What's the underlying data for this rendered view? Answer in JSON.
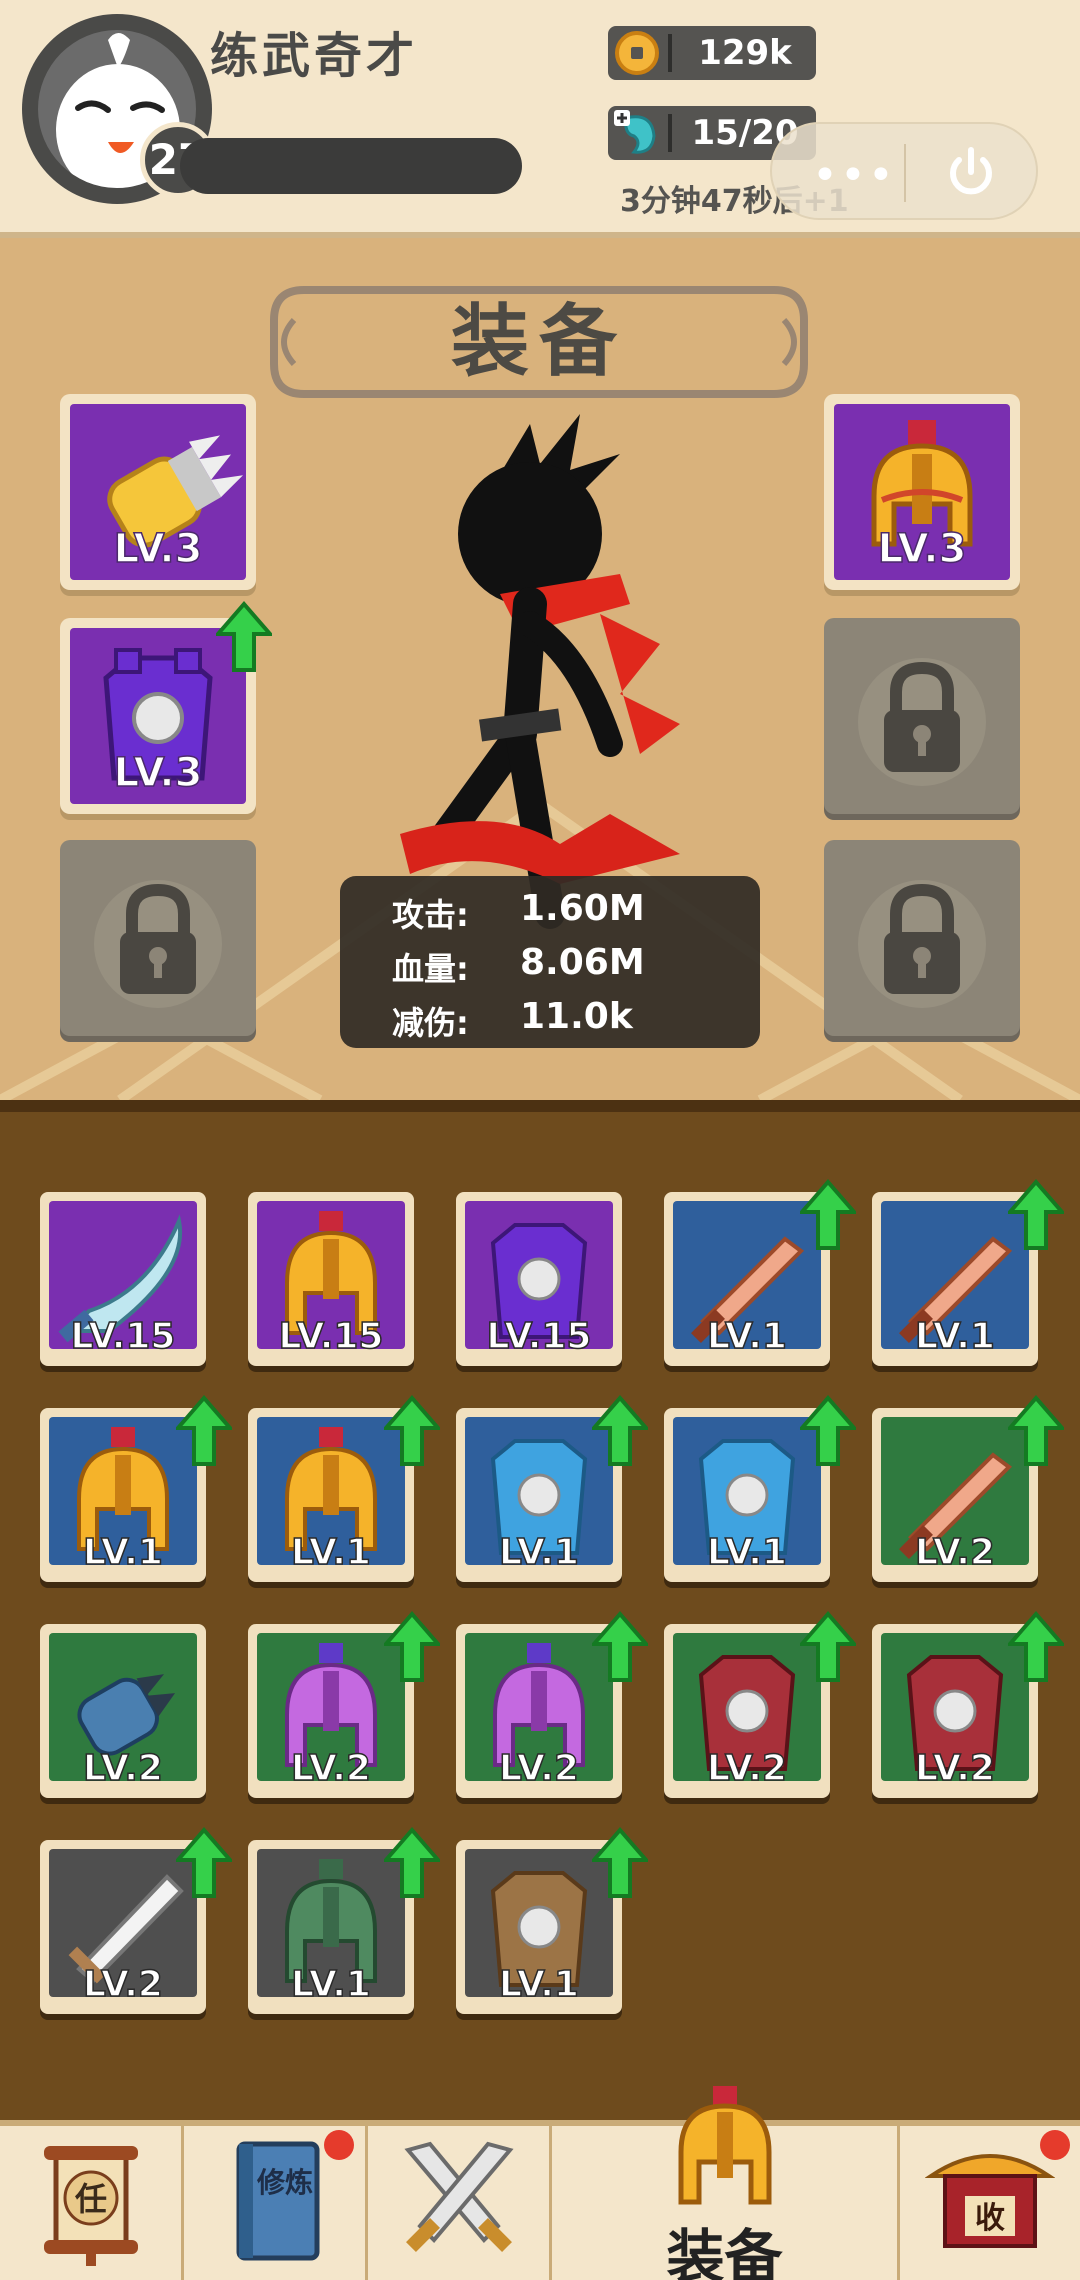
{
  "player": {
    "name": "练武奇才",
    "level": "27"
  },
  "resources": {
    "gold": "129k",
    "energy": "15/20",
    "timer": "3分钟47秒后+1"
  },
  "capsule": {
    "more_label": "•••"
  },
  "screen_title": "装备",
  "equipped": {
    "left": [
      {
        "lv": "LV.3",
        "rarity_color": "#7a2fb0",
        "type": "glove",
        "upgrade": false
      },
      {
        "lv": "LV.3",
        "rarity_color": "#7a2fb0",
        "type": "armor",
        "upgrade": true
      },
      {
        "locked": true
      }
    ],
    "right": [
      {
        "lv": "LV.3",
        "rarity_color": "#7a2fb0",
        "type": "helmet",
        "upgrade": false
      },
      {
        "locked": true
      },
      {
        "locked": true
      }
    ]
  },
  "stats": [
    {
      "label": "攻击:",
      "value": "1.60M"
    },
    {
      "label": "血量:",
      "value": "8.06M"
    },
    {
      "label": "减伤:",
      "value": "11.0k"
    }
  ],
  "inventory": [
    {
      "lv": "LV.15",
      "bg": "#7a2fb0",
      "type": "sword-curved",
      "upgrade": false
    },
    {
      "lv": "LV.15",
      "bg": "#7a2fb0",
      "type": "helmet",
      "upgrade": false
    },
    {
      "lv": "LV.15",
      "bg": "#7a2fb0",
      "type": "armor-purple",
      "upgrade": false
    },
    {
      "lv": "LV.1",
      "bg": "#2f5f9c",
      "type": "sword-wood",
      "upgrade": true
    },
    {
      "lv": "LV.1",
      "bg": "#2f5f9c",
      "type": "sword-wood",
      "upgrade": true
    },
    {
      "lv": "LV.1",
      "bg": "#2f5f9c",
      "type": "helmet",
      "upgrade": true
    },
    {
      "lv": "LV.1",
      "bg": "#2f5f9c",
      "type": "helmet",
      "upgrade": true
    },
    {
      "lv": "LV.1",
      "bg": "#2f5f9c",
      "type": "armor-blue",
      "upgrade": true
    },
    {
      "lv": "LV.1",
      "bg": "#2f5f9c",
      "type": "armor-blue",
      "upgrade": true
    },
    {
      "lv": "LV.2",
      "bg": "#2f7a3f",
      "type": "sword-wood",
      "upgrade": true
    },
    {
      "lv": "LV.2",
      "bg": "#2f7a3f",
      "type": "glove-blue",
      "upgrade": false
    },
    {
      "lv": "LV.2",
      "bg": "#2f7a3f",
      "type": "helmet-violet",
      "upgrade": true
    },
    {
      "lv": "LV.2",
      "bg": "#2f7a3f",
      "type": "helmet-violet",
      "upgrade": true
    },
    {
      "lv": "LV.2",
      "bg": "#2f7a3f",
      "type": "armor-red",
      "upgrade": true
    },
    {
      "lv": "LV.2",
      "bg": "#2f7a3f",
      "type": "armor-red",
      "upgrade": true
    },
    {
      "lv": "LV.2",
      "bg": "#4f4f4f",
      "type": "sword-steel",
      "upgrade": true
    },
    {
      "lv": "LV.1",
      "bg": "#4f4f4f",
      "type": "helmet-green",
      "upgrade": true
    },
    {
      "lv": "LV.1",
      "bg": "#4f4f4f",
      "type": "armor-brown",
      "upgrade": true
    }
  ],
  "nav": [
    {
      "name": "task",
      "icon_char": "任",
      "dot": false
    },
    {
      "name": "train",
      "icon_char": "修炼",
      "dot": true
    },
    {
      "name": "battle",
      "dot": false
    },
    {
      "name": "equip",
      "label": "装备",
      "dot": false
    },
    {
      "name": "collect",
      "icon_char": "收",
      "dot": true
    }
  ]
}
